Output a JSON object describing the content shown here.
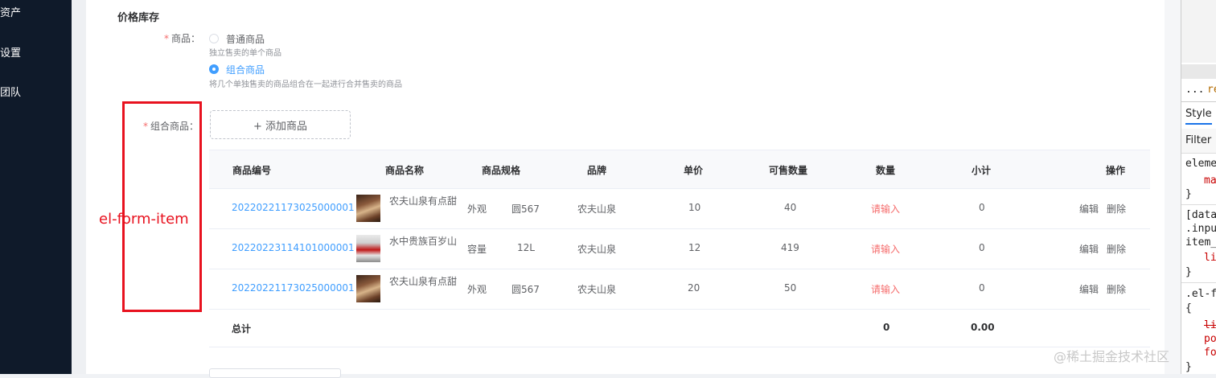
{
  "sidebar": {
    "items": [
      {
        "label": "资产"
      },
      {
        "label": "设置"
      },
      {
        "label": "团队"
      }
    ]
  },
  "form": {
    "section_title": "价格库存",
    "product_label": "商品：",
    "product_types": [
      {
        "label": "普通商品",
        "hint": "独立售卖的单个商品",
        "checked": false
      },
      {
        "label": "组合商品",
        "hint": "将几个单独售卖的商品组合在一起进行合并售卖的商品",
        "checked": true
      }
    ],
    "combo_label": "组合商品：",
    "add_button": "+ 添加商品",
    "annotation": "el-form-item"
  },
  "table": {
    "headers": [
      "商品编号",
      "商品名称",
      "商品规格",
      "品牌",
      "单价",
      "可售数量",
      "数量",
      "小计",
      "操作"
    ],
    "rows": [
      {
        "code": "2022022117302500000​1",
        "name": "农夫山泉有点甜",
        "spec_key": "外观",
        "spec_val": "圆567",
        "brand": "农夫山泉",
        "price": "10",
        "stock": "40",
        "qty_placeholder": "请输入",
        "subtotal": "0",
        "edit": "编辑",
        "delete": "删除",
        "thumb": "portrait"
      },
      {
        "code": "20220223114101000001",
        "name": "水中贵族百岁山",
        "spec_key": "容量",
        "spec_val": "12L",
        "brand": "农夫山泉",
        "price": "12",
        "stock": "419",
        "qty_placeholder": "请输入",
        "subtotal": "0",
        "edit": "编辑",
        "delete": "删除",
        "thumb": "bottle"
      },
      {
        "code": "20220221173025000001",
        "name": "农夫山泉有点甜",
        "spec_key": "外观",
        "spec_val": "圆567",
        "brand": "农夫山泉",
        "price": "20",
        "stock": "50",
        "qty_placeholder": "请输入",
        "subtotal": "0",
        "edit": "编辑",
        "delete": "删除",
        "thumb": "portrait"
      }
    ],
    "total_label": "总计",
    "total_qty": "0",
    "total_amount": "0.00"
  },
  "watermark": "@稀土掘金技术社区",
  "devtools": {
    "lines": [
      "...",
      "re",
      "Style",
      "Filter",
      "eleme",
      "ma",
      "}",
      "[data",
      ".inpu",
      "item_",
      "li",
      "}",
      ".el-f",
      "{",
      "li",
      "po",
      "fo",
      "}"
    ]
  },
  "colors": {
    "accent": "#409eff",
    "required": "#f56c6c",
    "annotation": "#e8121f",
    "sidebar": "#0f1a2a"
  }
}
